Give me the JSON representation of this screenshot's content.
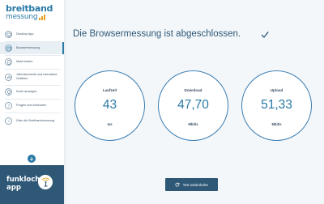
{
  "logo": {
    "top": "breitband",
    "bottom": "messung"
  },
  "sidebar": {
    "items": [
      {
        "label": "Desktop App",
        "icon": "desktop-icon",
        "active": false
      },
      {
        "label": "Browsermessung",
        "icon": "browser-icon",
        "active": true
      },
      {
        "label": "Mobil testen",
        "icon": "mobile-icon",
        "active": false
      },
      {
        "label": "Jahresberichte und interaktive Grafiken",
        "icon": "chart-icon",
        "active": false
      },
      {
        "label": "Karte anzeigen",
        "icon": "map-icon",
        "active": false
      },
      {
        "label": "Fragen und Antworten",
        "icon": "question-icon",
        "active": false
      },
      {
        "label": "Über die Breitbandmessung",
        "icon": "info-icon",
        "active": false
      }
    ]
  },
  "funkloch": {
    "line1": "funkloch-",
    "line2": "app"
  },
  "main": {
    "headline": "Die Browsermessung ist abgeschlossen.",
    "gauges": [
      {
        "label": "Laufzeit",
        "value": "43",
        "unit": "ms"
      },
      {
        "label": "Download",
        "value": "47,70",
        "unit": "Mbit/s"
      },
      {
        "label": "Upload",
        "value": "51,33",
        "unit": "Mbit/s"
      }
    ],
    "retry_label": "Test wiederholen"
  },
  "colors": {
    "primary": "#2a7aa5",
    "dark": "#2e5876",
    "accent": "#e8a020"
  }
}
